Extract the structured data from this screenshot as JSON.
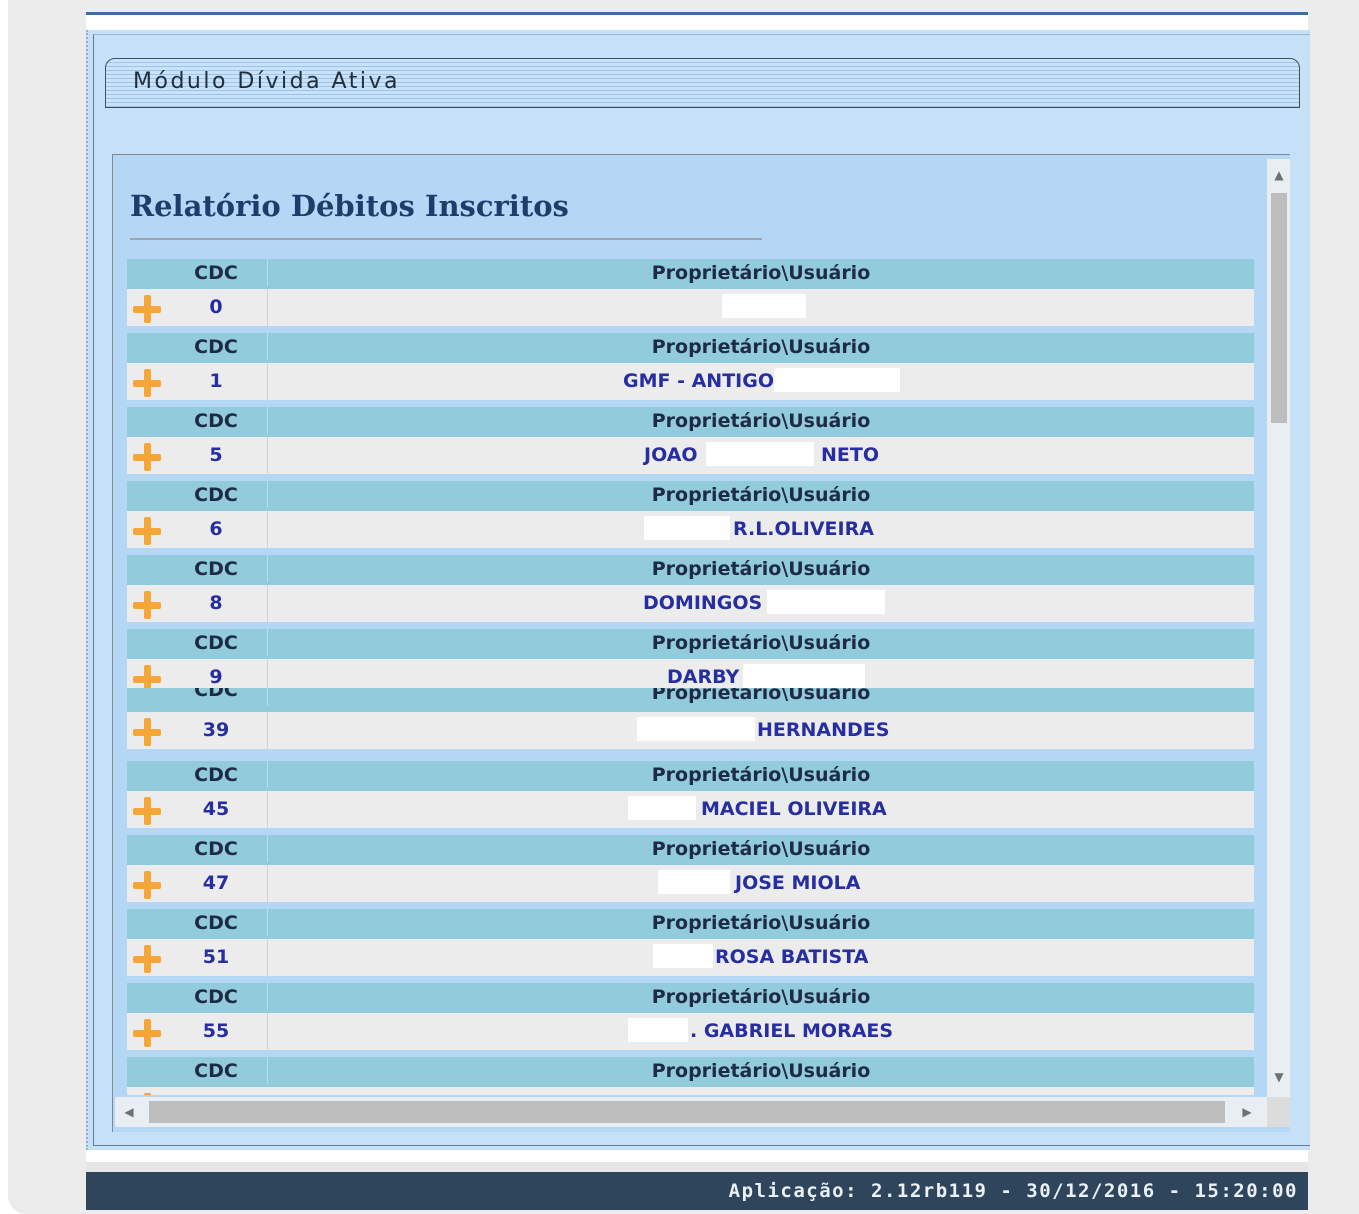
{
  "module": {
    "title": "Módulo Dívida Ativa"
  },
  "report": {
    "title": "Relatório Débitos Inscritos",
    "columns": {
      "cdc": "CDC",
      "owner": "Proprietário\\Usuário"
    },
    "rows": [
      {
        "cdc": "0",
        "owner_parts": []
      },
      {
        "cdc": "1",
        "owner_parts": [
          "GMF - ANTIGO"
        ]
      },
      {
        "cdc": "5",
        "owner_parts": [
          "JOAO",
          "NETO"
        ]
      },
      {
        "cdc": "6",
        "owner_parts": [
          "R.L.OLIVEIRA"
        ]
      },
      {
        "cdc": "8",
        "owner_parts": [
          "DOMINGOS"
        ]
      },
      {
        "cdc": "9",
        "owner_parts": [
          "DARBY"
        ]
      },
      {
        "cdc": "39",
        "owner_parts": [
          "HERNANDES"
        ]
      },
      {
        "cdc": "45",
        "owner_parts": [
          "MACIEL OLIVEIRA"
        ]
      },
      {
        "cdc": "47",
        "owner_parts": [
          "JOSE MIOLA"
        ]
      },
      {
        "cdc": "51",
        "owner_parts": [
          "ROSA BATISTA"
        ]
      },
      {
        "cdc": "55",
        "owner_parts": [
          ". GABRIEL MORAES"
        ]
      }
    ]
  },
  "footer": {
    "app_info": "Aplicação: 2.12rb119 - 30/12/2016 - 15:20:00"
  },
  "icons": {
    "expand": "plus-icon"
  },
  "colors": {
    "header_row": "#92cbdc",
    "data_text": "#262ea0",
    "expand_icon": "#f5a636",
    "footer_bg": "#2f455c"
  }
}
